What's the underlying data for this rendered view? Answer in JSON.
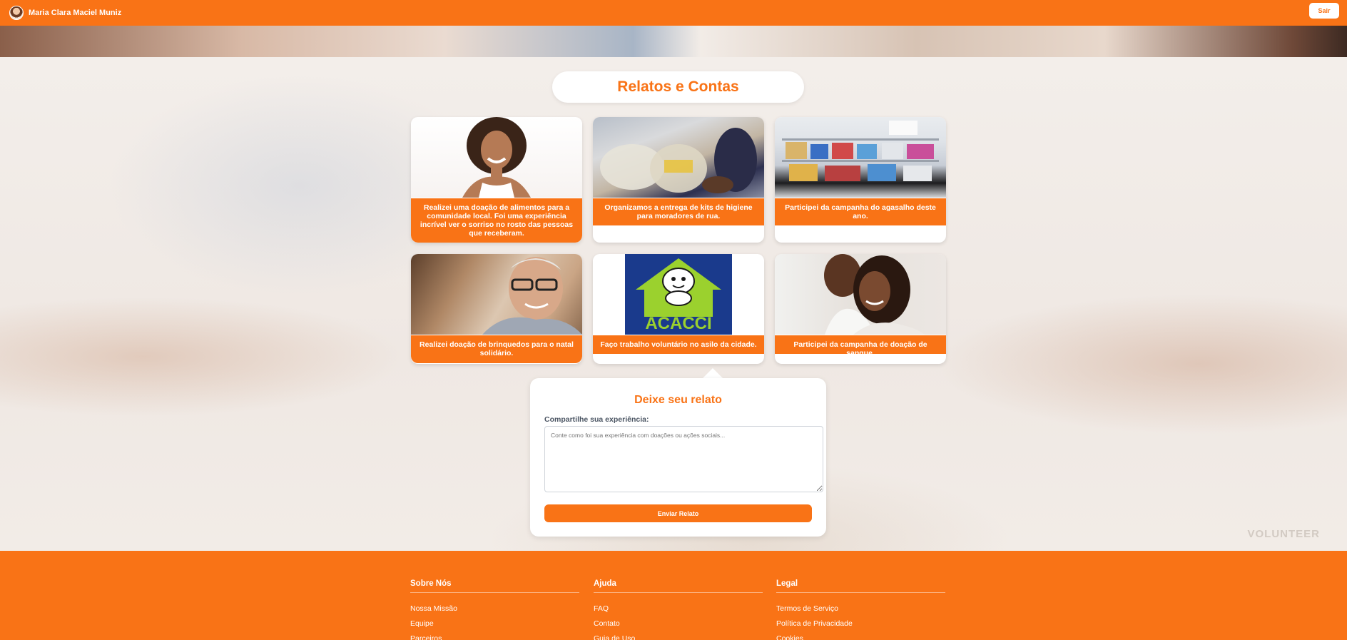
{
  "header": {
    "user_name": "Maria Clara Maciel Muniz",
    "logout_label": "Sair"
  },
  "page": {
    "title": "Relatos e Contas"
  },
  "cards": [
    {
      "image": "smiling-woman-photo",
      "caption": "Realizei uma doação de alimentos para a comunidade local. Foi uma experiência incrível ver o sorriso no rosto das pessoas que receberam."
    },
    {
      "image": "food-bags-photo",
      "caption": "Organizamos a entrega de kits de higiene para moradores de rua."
    },
    {
      "image": "supply-shelf-photo",
      "caption": "Participei da campanha do agasalho deste ano."
    },
    {
      "image": "elderly-man-photo",
      "caption": "Realizei doação de brinquedos para o natal solidário."
    },
    {
      "image": "acacci-logo",
      "caption": "Faço trabalho voluntário no asilo da cidade.",
      "logo_text": "ACACCI"
    },
    {
      "image": "couple-photo",
      "caption": "Participei da campanha de doação de sangue."
    }
  ],
  "form": {
    "title": "Deixe seu relato",
    "label": "Compartilhe sua experiência:",
    "placeholder": "Conte como foi sua experiência com doações ou ações sociais...",
    "submit_label": "Enviar Relato"
  },
  "footer": {
    "columns": [
      {
        "heading": "Sobre Nós",
        "links": [
          "Nossa Missão",
          "Equipe",
          "Parceiros"
        ]
      },
      {
        "heading": "Ajuda",
        "links": [
          "FAQ",
          "Contato",
          "Guia de Uso"
        ]
      },
      {
        "heading": "Legal",
        "links": [
          "Termos de Serviço",
          "Política de Privacidade",
          "Cookies"
        ]
      }
    ]
  },
  "colors": {
    "accent": "#f97316",
    "white": "#ffffff"
  },
  "background": {
    "watermark": "VOLUNTEER"
  }
}
